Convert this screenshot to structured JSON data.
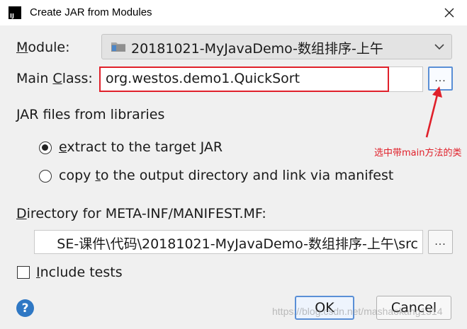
{
  "dialog": {
    "title": "Create JAR from Modules",
    "close_icon": "close-icon"
  },
  "module": {
    "label": "Module:",
    "value": "20181021-MyJavaDemo-数组排序-上午"
  },
  "main_class": {
    "label": "Main Class:",
    "value": "org.westos.demo1.QuickSort",
    "browse_label": "..."
  },
  "jar_files": {
    "heading": "JAR files from libraries",
    "options": [
      {
        "label": "extract to the target JAR",
        "selected": true
      },
      {
        "label": "copy to the output directory and link via manifest",
        "selected": false
      }
    ]
  },
  "manifest": {
    "label": "Directory for META-INF/MANIFEST.MF:",
    "value": "SE-课件\\代码\\20181021-MyJavaDemo-数组排序-上午\\src",
    "browse_label": "..."
  },
  "include_tests": {
    "label": "Include tests",
    "checked": false
  },
  "annotation": {
    "text": "选中带main方法的类",
    "color": "#e0202a"
  },
  "buttons": {
    "help": "?",
    "ok": "OK",
    "cancel": "Cancel"
  },
  "watermark": "https://blog.csdn.net/mashaokang1314",
  "colors": {
    "accent": "#5a8fd6",
    "highlight_red": "#e0202a",
    "help_blue": "#2f78c4"
  }
}
